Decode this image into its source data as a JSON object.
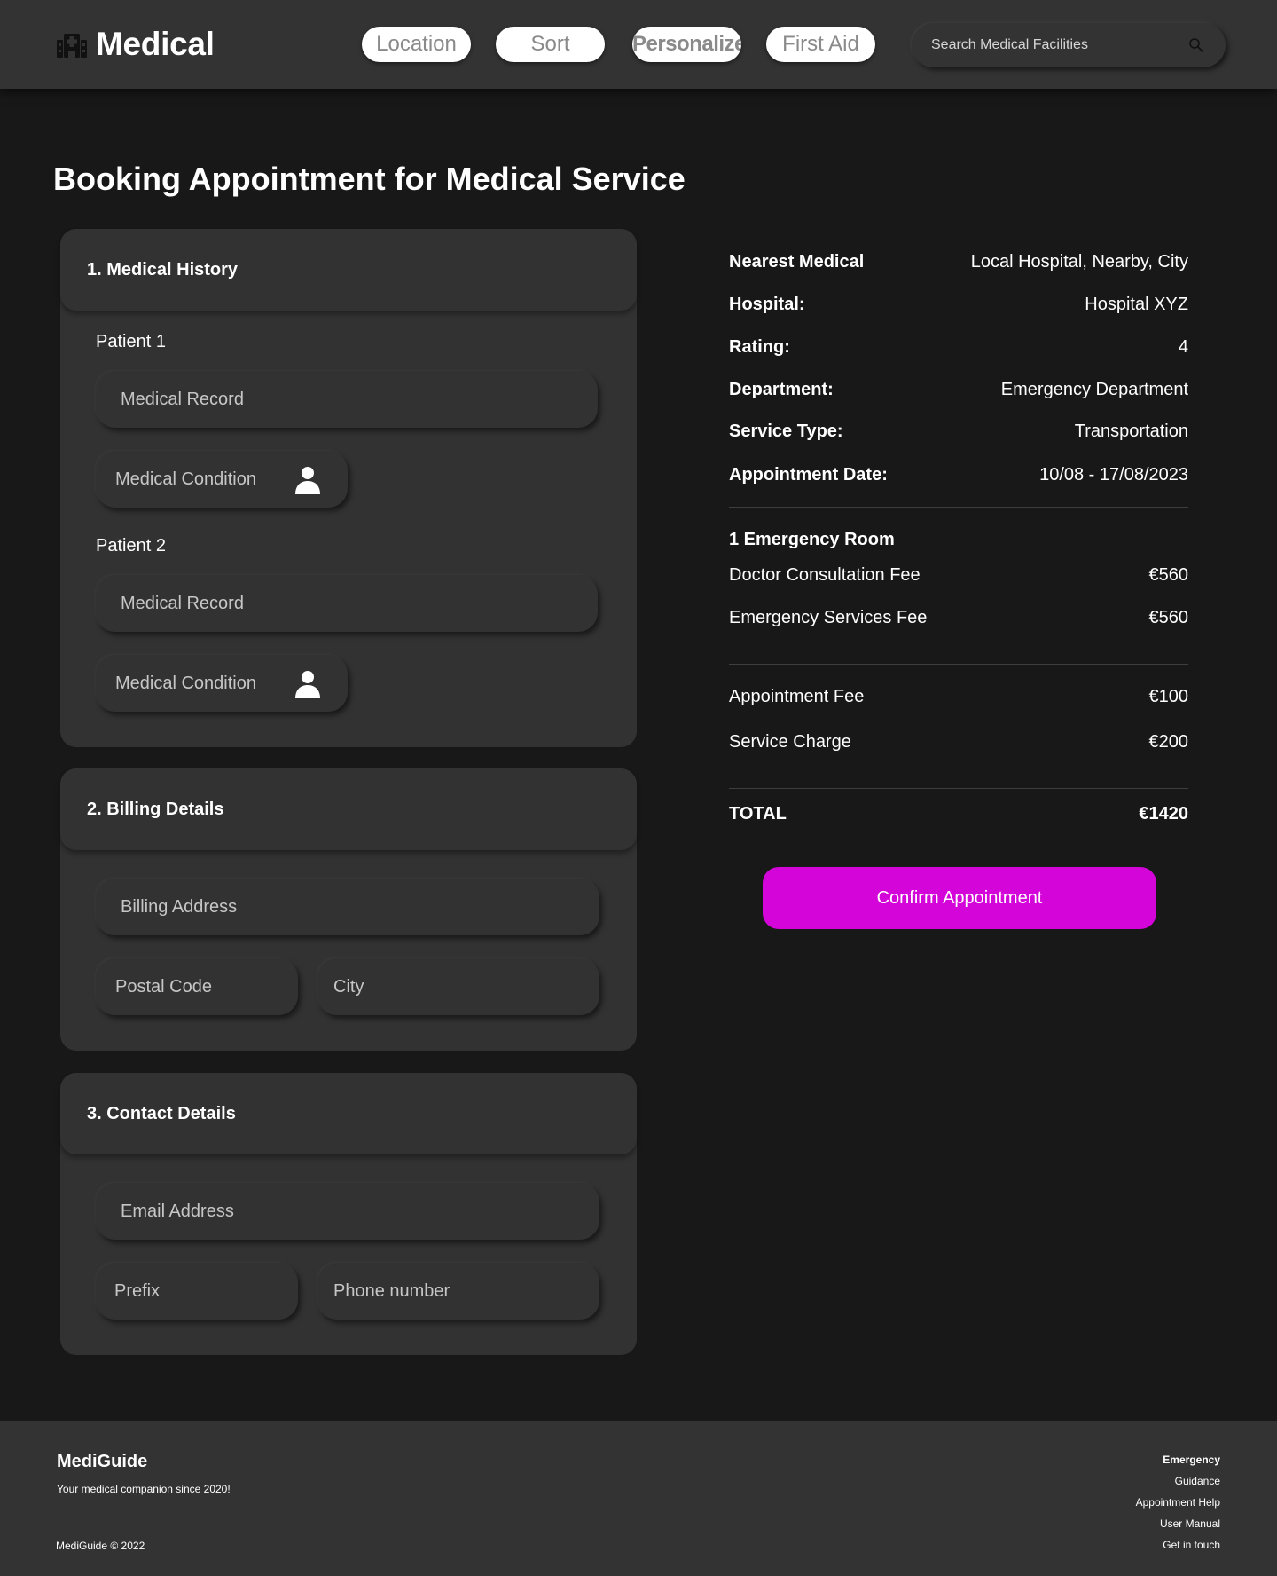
{
  "header": {
    "brand": "Medical",
    "nav": [
      "Location",
      "Sort",
      "Personalize",
      "First Aid"
    ],
    "search_placeholder": "Search Medical Facilities"
  },
  "page_title": "Booking Appointment for Medical Service",
  "medical_history": {
    "title": "1. Medical History",
    "patients": [
      {
        "label": "Patient 1",
        "record_placeholder": "Medical Record",
        "condition_placeholder": "Medical Condition"
      },
      {
        "label": "Patient 2",
        "record_placeholder": "Medical Record",
        "condition_placeholder": "Medical Condition"
      }
    ]
  },
  "billing": {
    "title": "2. Billing Details",
    "address_placeholder": "Billing Address",
    "postal_placeholder": "Postal Code",
    "city_placeholder": "City"
  },
  "contact": {
    "title": "3. Contact Details",
    "email_placeholder": "Email Address",
    "prefix_placeholder": "Prefix",
    "phone_placeholder": "Phone number"
  },
  "summary": {
    "details": [
      {
        "label": "Nearest Medical",
        "value": "Local Hospital, Nearby, City"
      },
      {
        "label": "Hospital:",
        "value": "Hospital XYZ"
      },
      {
        "label": "Rating:",
        "value": "4"
      },
      {
        "label": "Department:",
        "value": "Emergency Department"
      },
      {
        "label": "Service Type:",
        "value": "Transportation"
      },
      {
        "label": "Appointment Date:",
        "value": "10/08 - 17/08/2023"
      }
    ],
    "room_title": "1 Emergency Room",
    "room_fees": [
      {
        "label": "Doctor Consultation Fee",
        "value": "€560"
      },
      {
        "label": "Emergency Services Fee",
        "value": "€560"
      }
    ],
    "extra_fees": [
      {
        "label": "Appointment Fee",
        "value": "€100"
      },
      {
        "label": "Service Charge",
        "value": "€200"
      }
    ],
    "total_label": "TOTAL",
    "total_value": "€1420",
    "confirm_label": "Confirm Appointment"
  },
  "footer": {
    "brand": "MediGuide",
    "tagline": "Your medical companion since 2020!",
    "copyright": "MediGuide © 2022",
    "links": [
      "Emergency",
      "Guidance",
      "Appointment Help",
      "User Manual",
      "Get in touch"
    ]
  },
  "colors": {
    "background": "#181818",
    "surface": "#333333",
    "accent": "#d305d9",
    "pill": "#ffffff"
  }
}
